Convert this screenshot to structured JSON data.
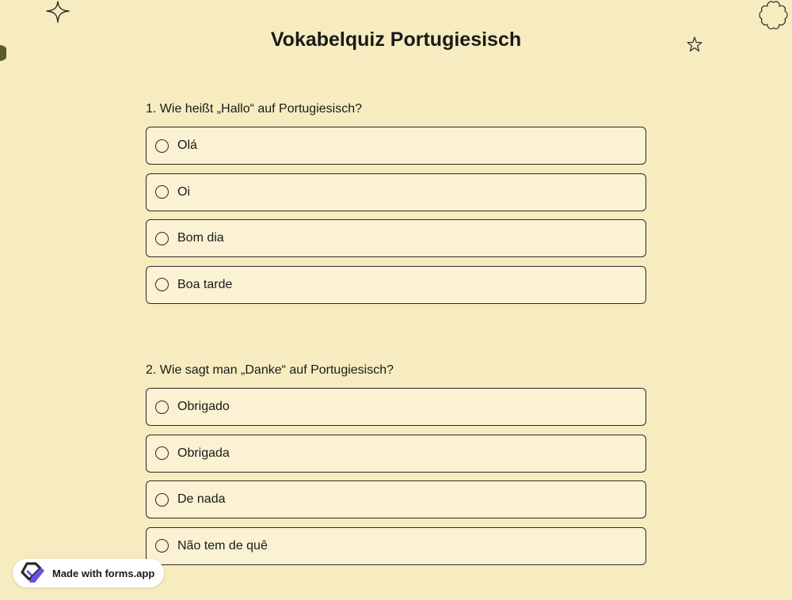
{
  "page": {
    "title": "Vokabelquiz Portugiesisch"
  },
  "questions": [
    {
      "label": "1.  Wie heißt „Hallo“ auf Portugiesisch?",
      "options": [
        "Olá",
        "Oi",
        "Bom dia",
        "Boa tarde"
      ]
    },
    {
      "label": "2. Wie sagt man „Danke“ auf Portugiesisch?",
      "options": [
        "Obrigado",
        "Obrigada",
        "De nada",
        "Não tem de quê"
      ]
    }
  ],
  "badge": {
    "label": "Made with forms.app"
  },
  "colors": {
    "background": "#f6ecbf",
    "option_background": "#faf2d2",
    "border": "#2b2b2b",
    "brand_purple": "#6b4ef0"
  },
  "icons": {
    "decorations": [
      "sparkle-icon",
      "star-icon",
      "flower-outline-icon",
      "half-circle-icon"
    ],
    "radio": "radio-unchecked-icon",
    "brand": "forms-app-logo-icon"
  }
}
